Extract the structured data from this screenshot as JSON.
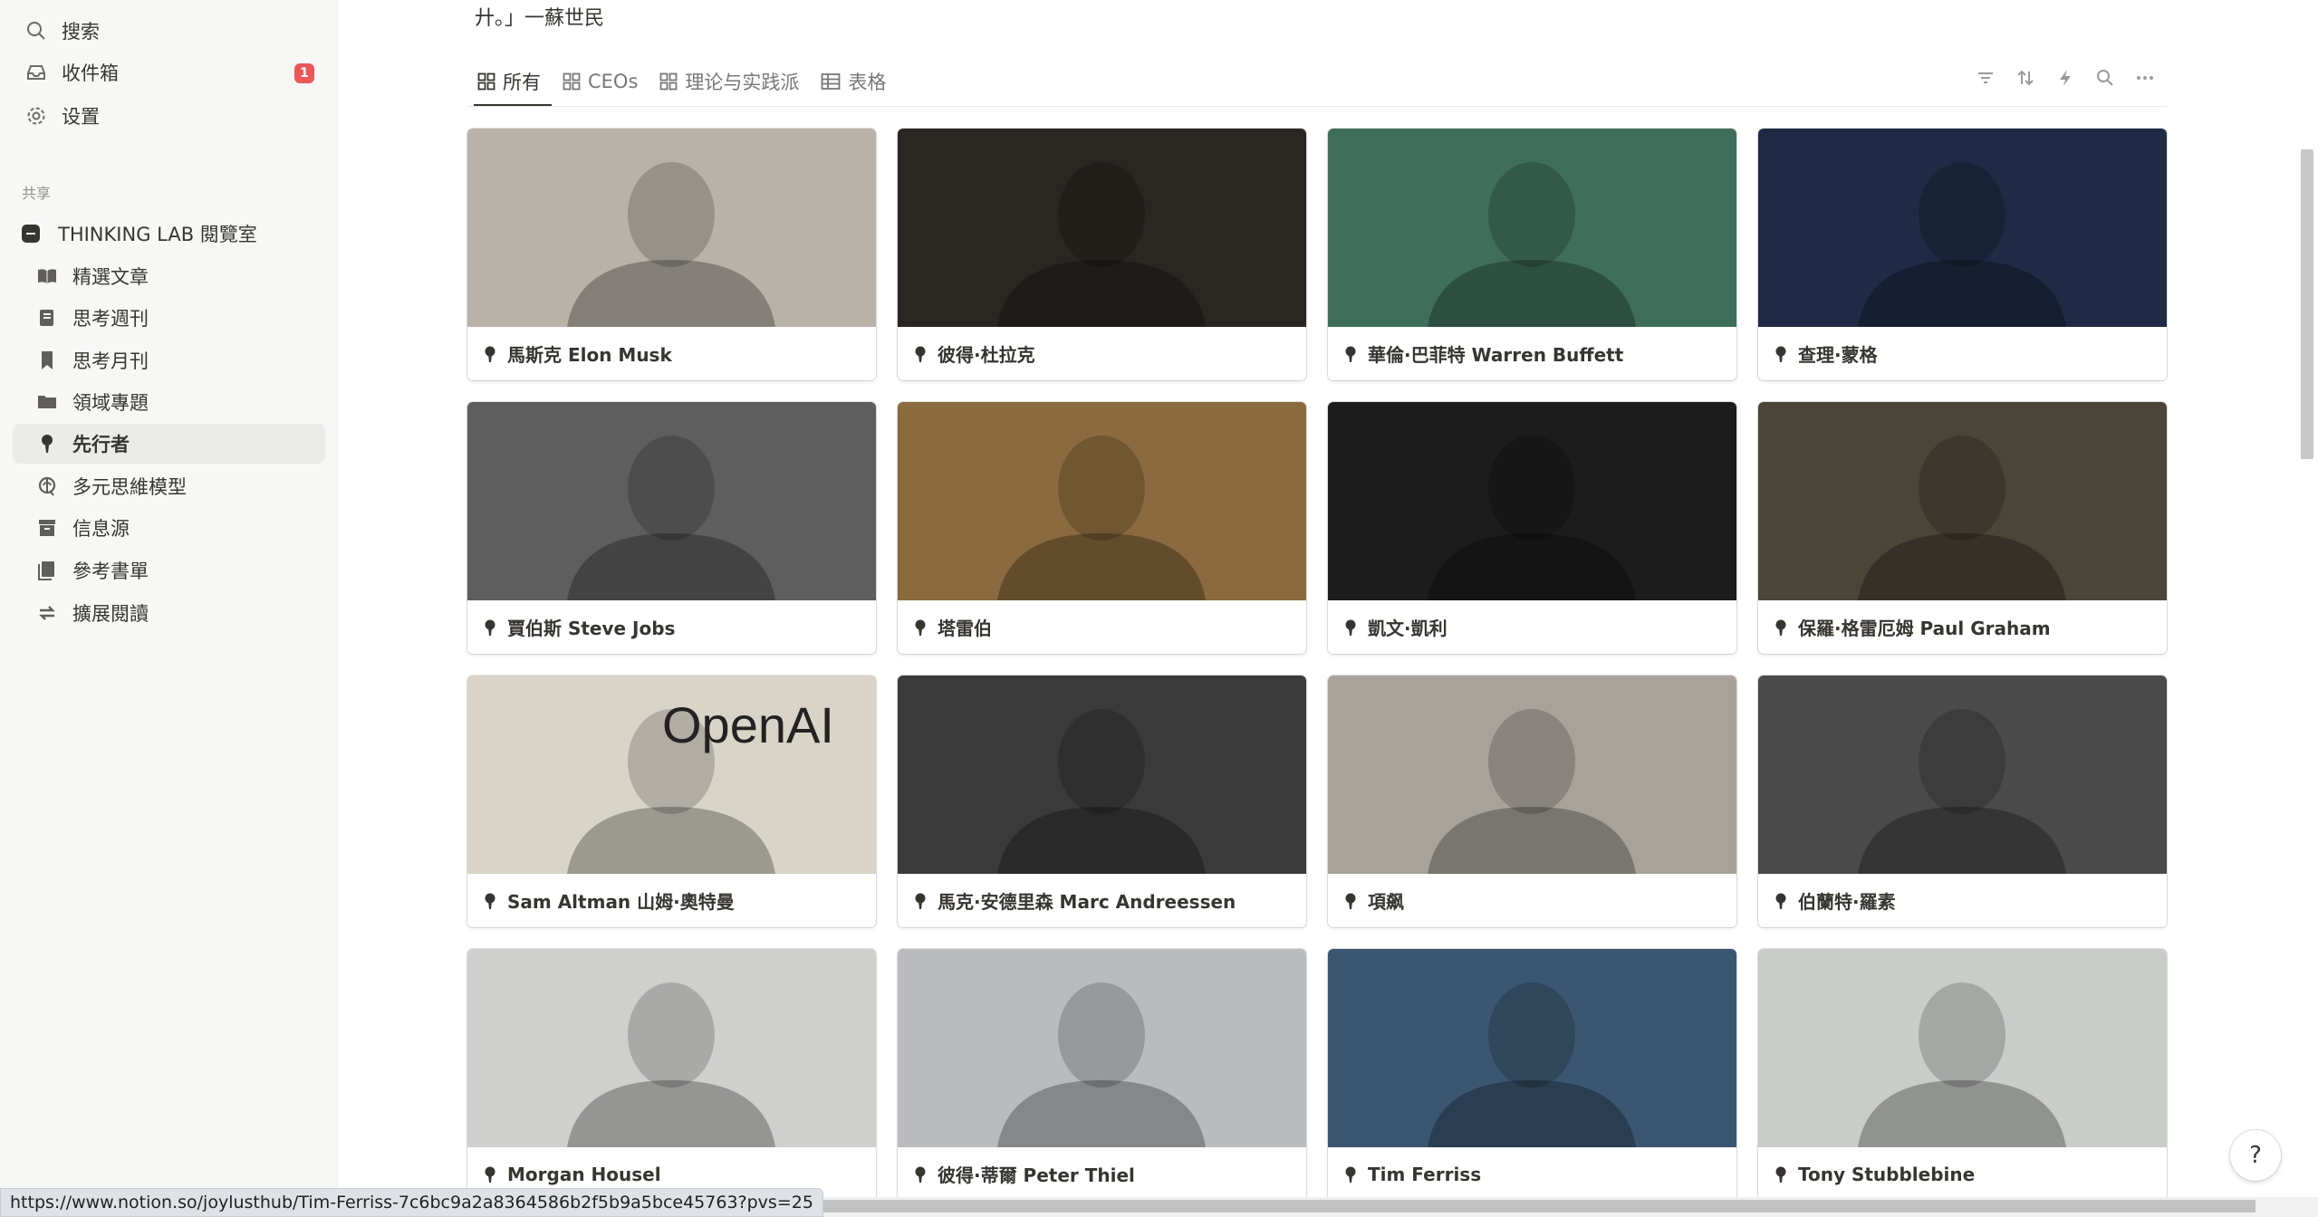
{
  "sidebar": {
    "top_items": [
      {
        "label": "搜索",
        "icon": "search-icon"
      },
      {
        "label": "收件箱",
        "icon": "inbox-icon",
        "badge": "1"
      },
      {
        "label": "设置",
        "icon": "gear-icon"
      }
    ],
    "section_label": "共享",
    "workspace": "THINKING LAB 閱覽室",
    "pages": [
      {
        "label": "精選文章",
        "icon": "book-open-icon"
      },
      {
        "label": "思考週刊",
        "icon": "journal-icon"
      },
      {
        "label": "思考月刊",
        "icon": "bookmark-icon"
      },
      {
        "label": "領域專題",
        "icon": "folder-icon"
      },
      {
        "label": "先行者",
        "icon": "person-icon",
        "active": true
      },
      {
        "label": "多元思維模型",
        "icon": "brain-icon"
      },
      {
        "label": "信息源",
        "icon": "archive-icon"
      },
      {
        "label": "參考書單",
        "icon": "books-icon"
      },
      {
        "label": "擴展閱讀",
        "icon": "sync-icon"
      }
    ]
  },
  "main": {
    "quote": "廾。」一蘇世民",
    "tabs": [
      {
        "label": "所有",
        "icon": "gallery-icon",
        "active": true
      },
      {
        "label": "CEOs",
        "icon": "gallery-icon"
      },
      {
        "label": "理论与实践派",
        "icon": "gallery-icon"
      },
      {
        "label": "表格",
        "icon": "table-icon"
      }
    ],
    "toolbar": [
      "filter-icon",
      "sort-icon",
      "lightning-icon",
      "search-icon",
      "more-icon"
    ]
  },
  "gallery": [
    {
      "name": "馬斯克 Elon Musk",
      "bg": "#b8b2a8"
    },
    {
      "name": "彼得·杜拉克",
      "bg": "#2a2622"
    },
    {
      "name": "華倫·巴菲特 Warren Buffett",
      "bg": "#3f6e5a"
    },
    {
      "name": "查理·蒙格",
      "bg": "#1f2b45"
    },
    {
      "name": "賈伯斯 Steve Jobs",
      "bg": "#5e5e5e"
    },
    {
      "name": "塔雷伯",
      "bg": "#8a6a3e"
    },
    {
      "name": "凱文·凱利",
      "bg": "#1c1c1c"
    },
    {
      "name": "保羅·格雷厄姆 Paul Graham",
      "bg": "#4b4538"
    },
    {
      "name": "Sam Altman 山姆·奧特曼",
      "bg": "#d8d4c8",
      "overlay_text": "OpenAI"
    },
    {
      "name": "馬克·安德里森 Marc Andreessen",
      "bg": "#3a3a3a"
    },
    {
      "name": "項飙",
      "bg": "#a8a39a"
    },
    {
      "name": "伯蘭特·羅素",
      "bg": "#4a4a4a"
    },
    {
      "name": "Morgan Housel",
      "bg": "#cfcfcd"
    },
    {
      "name": "彼得·蒂爾 Peter Thiel",
      "bg": "#b9bbbd"
    },
    {
      "name": "Tim Ferriss",
      "bg": "#3a5670"
    },
    {
      "name": "Tony Stubblebine",
      "bg": "#c9ccc8"
    }
  ],
  "status_url": "https://www.notion.so/joylusthub/Tim-Ferriss-7c6bc9a2a8364586b2f5b9a5bce45763?pvs=25",
  "help_label": "?",
  "colors": {
    "accent": "#37352f",
    "badge": "#eb5757",
    "sidebar_bg": "#f7f7f5"
  }
}
